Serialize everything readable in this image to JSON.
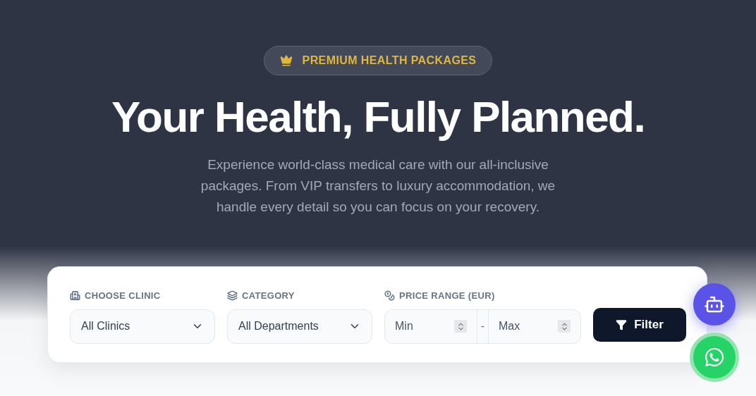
{
  "badge": {
    "label": "PREMIUM HEALTH PACKAGES"
  },
  "title": "Your Health, Fully Planned.",
  "subtitle": "Experience world-class medical care with our all-inclusive packages. From VIP transfers to luxury accommodation, we handle every detail so you can focus on your recovery.",
  "filters": {
    "clinic": {
      "label": "CHOOSE CLINIC",
      "value": "All Clinics"
    },
    "category": {
      "label": "CATEGORY",
      "value": "All Departments"
    },
    "price": {
      "label": "PRICE RANGE (EUR)",
      "min_placeholder": "Min",
      "separator": "-",
      "max_placeholder": "Max"
    },
    "button": "Filter"
  }
}
